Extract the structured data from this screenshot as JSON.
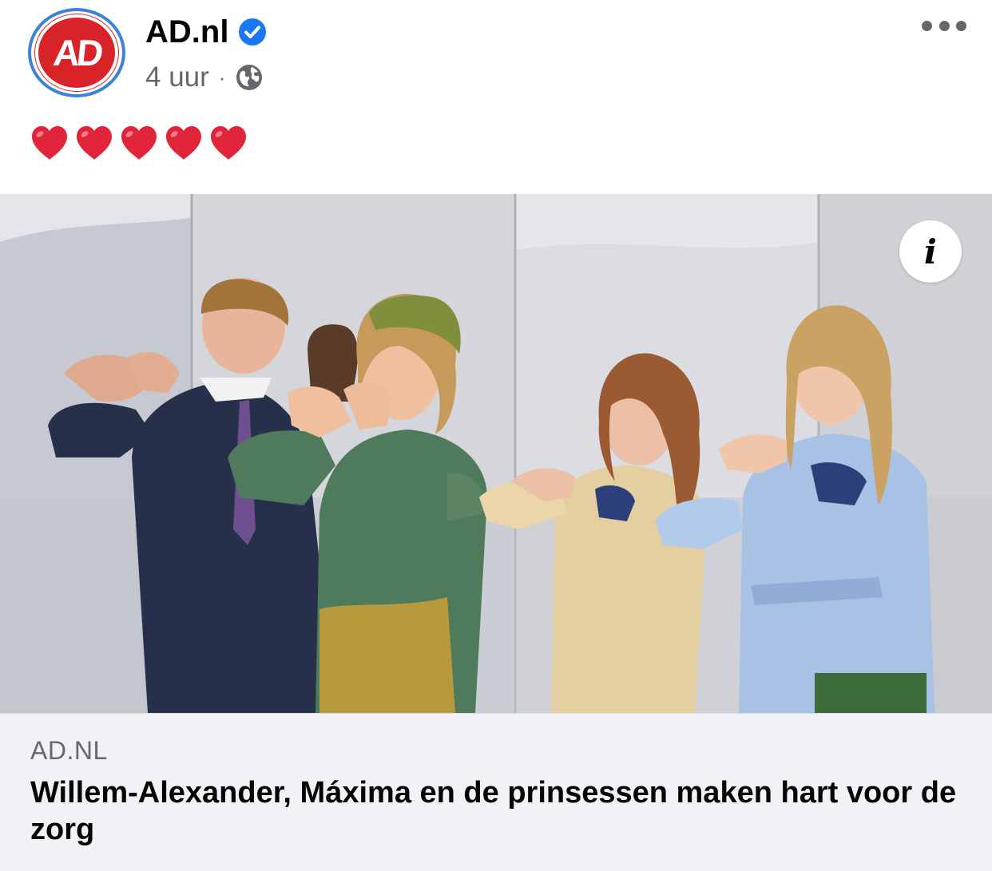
{
  "post": {
    "page_name": "AD.nl",
    "avatar_text": "AD",
    "time": "4 uur",
    "separator": "·",
    "visibility_icon": "globe-icon",
    "verified_icon": "verified-badge-icon",
    "more_icon": "more-options-icon",
    "emoji_text": [
      "heart",
      "heart",
      "heart",
      "heart",
      "heart"
    ]
  },
  "media": {
    "info_label": "i"
  },
  "link": {
    "domain": "AD.NL",
    "title": "Willem-Alexander, Máxima en de prinsessen maken hart voor de zorg"
  },
  "colors": {
    "brand_red": "#d82329",
    "verified_blue": "#1877f2",
    "avatar_ring": "#3c82d6",
    "heart_red": "#e0243a",
    "footer_bg": "#f0f2f5"
  }
}
